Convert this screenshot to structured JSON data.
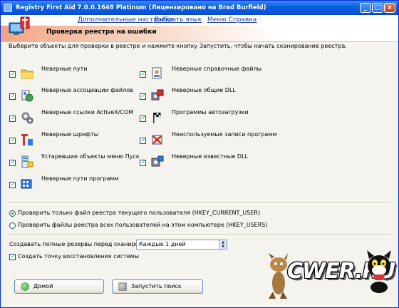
{
  "window": {
    "title": "Registry First Aid 7.0.0.1648 Platinum (Лицензировано на Brad Burfield)",
    "minimize": "_",
    "maximize": "□",
    "close": "×"
  },
  "menu": [
    {
      "label": "Дополнительные настройки"
    },
    {
      "label": "Выбрать язык"
    },
    {
      "label": "Меню Справка"
    }
  ],
  "header": {
    "title": "Проверка реестра на ошибки"
  },
  "instruction": "Выберите объекты для проверки в реестре и нажмите кнопку Запустить, чтобы начать сканирование реестра.",
  "check_items_left": [
    {
      "label": "Неверные пути",
      "checked": true,
      "icon": "folder-icon"
    },
    {
      "label": "Неверные ассоциации файлов",
      "checked": true,
      "icon": "file-association-icon"
    },
    {
      "label": "Неверные ссылки ActiveX/COM",
      "checked": true,
      "icon": "gears-icon"
    },
    {
      "label": "Неверные шрифты",
      "checked": true,
      "icon": "font-icon"
    },
    {
      "label": "Устаревшие объекты меню Пуск",
      "checked": true,
      "icon": "start-menu-icon"
    },
    {
      "label": "Неверные пути программ",
      "checked": true,
      "icon": "program-paths-icon"
    }
  ],
  "check_items_right": [
    {
      "label": "Неверные справочные файлы",
      "checked": true,
      "icon": "help-file-icon"
    },
    {
      "label": "Неверные общие DLL",
      "checked": true,
      "icon": "shared-dll-icon"
    },
    {
      "label": "Программы автозагрузки",
      "checked": true,
      "icon": "startup-flag-icon"
    },
    {
      "label": "Неиспользуемые записи программ",
      "checked": true,
      "icon": "unused-entries-icon"
    },
    {
      "label": "Неверные известные DLL",
      "checked": true,
      "icon": "known-dll-icon"
    }
  ],
  "scope": {
    "options": [
      {
        "label": "Проверить только файл реестра текущего пользователя (HKEY_CURRENT_USER)",
        "selected": true
      },
      {
        "label": "Проверить файлы реестра всех пользователей на этом компьютере (HKEY_USERS)",
        "selected": false
      }
    ]
  },
  "backup": {
    "label": "Создавать полные резервы перед сканированием:",
    "selected": "Каждые 1 дней"
  },
  "restore_point": {
    "label": "Создать точку восстановления системы",
    "checked": true
  },
  "buttons": {
    "home": "Домой",
    "start": "Запустить поиск"
  },
  "watermark": {
    "text": "CWER.RU"
  },
  "colors": {
    "titlebar": "#0a5de0",
    "link": "#1d3fb0",
    "header_gradient_start": "#f0a483",
    "check_mark": "#21a121"
  }
}
